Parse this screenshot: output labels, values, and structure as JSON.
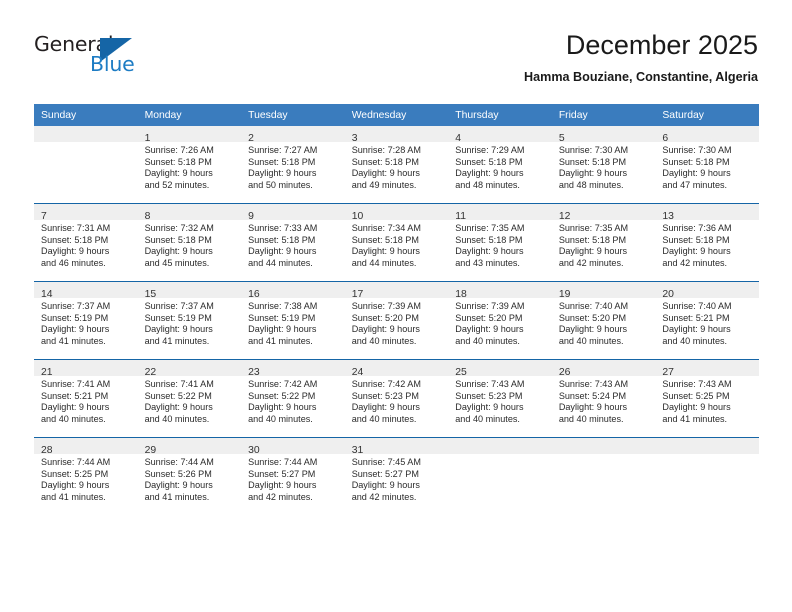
{
  "brand": {
    "name_top": "General",
    "name_bottom": "Blue",
    "accent_color": "#1d7cc4",
    "triangle_color": "#1565a6"
  },
  "header": {
    "title": "December 2025",
    "subtitle": "Hamma Bouziane, Constantine, Algeria"
  },
  "calendar": {
    "header_bg": "#3a7cbe",
    "row_border_color": "#1565a6",
    "daynum_bg": "#efefef",
    "weekdays": [
      "Sunday",
      "Monday",
      "Tuesday",
      "Wednesday",
      "Thursday",
      "Friday",
      "Saturday"
    ],
    "weeks": [
      [
        {
          "day": "",
          "lines": []
        },
        {
          "day": "1",
          "lines": [
            "Sunrise: 7:26 AM",
            "Sunset: 5:18 PM",
            "Daylight: 9 hours",
            "and 52 minutes."
          ]
        },
        {
          "day": "2",
          "lines": [
            "Sunrise: 7:27 AM",
            "Sunset: 5:18 PM",
            "Daylight: 9 hours",
            "and 50 minutes."
          ]
        },
        {
          "day": "3",
          "lines": [
            "Sunrise: 7:28 AM",
            "Sunset: 5:18 PM",
            "Daylight: 9 hours",
            "and 49 minutes."
          ]
        },
        {
          "day": "4",
          "lines": [
            "Sunrise: 7:29 AM",
            "Sunset: 5:18 PM",
            "Daylight: 9 hours",
            "and 48 minutes."
          ]
        },
        {
          "day": "5",
          "lines": [
            "Sunrise: 7:30 AM",
            "Sunset: 5:18 PM",
            "Daylight: 9 hours",
            "and 48 minutes."
          ]
        },
        {
          "day": "6",
          "lines": [
            "Sunrise: 7:30 AM",
            "Sunset: 5:18 PM",
            "Daylight: 9 hours",
            "and 47 minutes."
          ]
        }
      ],
      [
        {
          "day": "7",
          "lines": [
            "Sunrise: 7:31 AM",
            "Sunset: 5:18 PM",
            "Daylight: 9 hours",
            "and 46 minutes."
          ]
        },
        {
          "day": "8",
          "lines": [
            "Sunrise: 7:32 AM",
            "Sunset: 5:18 PM",
            "Daylight: 9 hours",
            "and 45 minutes."
          ]
        },
        {
          "day": "9",
          "lines": [
            "Sunrise: 7:33 AM",
            "Sunset: 5:18 PM",
            "Daylight: 9 hours",
            "and 44 minutes."
          ]
        },
        {
          "day": "10",
          "lines": [
            "Sunrise: 7:34 AM",
            "Sunset: 5:18 PM",
            "Daylight: 9 hours",
            "and 44 minutes."
          ]
        },
        {
          "day": "11",
          "lines": [
            "Sunrise: 7:35 AM",
            "Sunset: 5:18 PM",
            "Daylight: 9 hours",
            "and 43 minutes."
          ]
        },
        {
          "day": "12",
          "lines": [
            "Sunrise: 7:35 AM",
            "Sunset: 5:18 PM",
            "Daylight: 9 hours",
            "and 42 minutes."
          ]
        },
        {
          "day": "13",
          "lines": [
            "Sunrise: 7:36 AM",
            "Sunset: 5:18 PM",
            "Daylight: 9 hours",
            "and 42 minutes."
          ]
        }
      ],
      [
        {
          "day": "14",
          "lines": [
            "Sunrise: 7:37 AM",
            "Sunset: 5:19 PM",
            "Daylight: 9 hours",
            "and 41 minutes."
          ]
        },
        {
          "day": "15",
          "lines": [
            "Sunrise: 7:37 AM",
            "Sunset: 5:19 PM",
            "Daylight: 9 hours",
            "and 41 minutes."
          ]
        },
        {
          "day": "16",
          "lines": [
            "Sunrise: 7:38 AM",
            "Sunset: 5:19 PM",
            "Daylight: 9 hours",
            "and 41 minutes."
          ]
        },
        {
          "day": "17",
          "lines": [
            "Sunrise: 7:39 AM",
            "Sunset: 5:20 PM",
            "Daylight: 9 hours",
            "and 40 minutes."
          ]
        },
        {
          "day": "18",
          "lines": [
            "Sunrise: 7:39 AM",
            "Sunset: 5:20 PM",
            "Daylight: 9 hours",
            "and 40 minutes."
          ]
        },
        {
          "day": "19",
          "lines": [
            "Sunrise: 7:40 AM",
            "Sunset: 5:20 PM",
            "Daylight: 9 hours",
            "and 40 minutes."
          ]
        },
        {
          "day": "20",
          "lines": [
            "Sunrise: 7:40 AM",
            "Sunset: 5:21 PM",
            "Daylight: 9 hours",
            "and 40 minutes."
          ]
        }
      ],
      [
        {
          "day": "21",
          "lines": [
            "Sunrise: 7:41 AM",
            "Sunset: 5:21 PM",
            "Daylight: 9 hours",
            "and 40 minutes."
          ]
        },
        {
          "day": "22",
          "lines": [
            "Sunrise: 7:41 AM",
            "Sunset: 5:22 PM",
            "Daylight: 9 hours",
            "and 40 minutes."
          ]
        },
        {
          "day": "23",
          "lines": [
            "Sunrise: 7:42 AM",
            "Sunset: 5:22 PM",
            "Daylight: 9 hours",
            "and 40 minutes."
          ]
        },
        {
          "day": "24",
          "lines": [
            "Sunrise: 7:42 AM",
            "Sunset: 5:23 PM",
            "Daylight: 9 hours",
            "and 40 minutes."
          ]
        },
        {
          "day": "25",
          "lines": [
            "Sunrise: 7:43 AM",
            "Sunset: 5:23 PM",
            "Daylight: 9 hours",
            "and 40 minutes."
          ]
        },
        {
          "day": "26",
          "lines": [
            "Sunrise: 7:43 AM",
            "Sunset: 5:24 PM",
            "Daylight: 9 hours",
            "and 40 minutes."
          ]
        },
        {
          "day": "27",
          "lines": [
            "Sunrise: 7:43 AM",
            "Sunset: 5:25 PM",
            "Daylight: 9 hours",
            "and 41 minutes."
          ]
        }
      ],
      [
        {
          "day": "28",
          "lines": [
            "Sunrise: 7:44 AM",
            "Sunset: 5:25 PM",
            "Daylight: 9 hours",
            "and 41 minutes."
          ]
        },
        {
          "day": "29",
          "lines": [
            "Sunrise: 7:44 AM",
            "Sunset: 5:26 PM",
            "Daylight: 9 hours",
            "and 41 minutes."
          ]
        },
        {
          "day": "30",
          "lines": [
            "Sunrise: 7:44 AM",
            "Sunset: 5:27 PM",
            "Daylight: 9 hours",
            "and 42 minutes."
          ]
        },
        {
          "day": "31",
          "lines": [
            "Sunrise: 7:45 AM",
            "Sunset: 5:27 PM",
            "Daylight: 9 hours",
            "and 42 minutes."
          ]
        },
        {
          "day": "",
          "lines": []
        },
        {
          "day": "",
          "lines": []
        },
        {
          "day": "",
          "lines": []
        }
      ]
    ]
  }
}
